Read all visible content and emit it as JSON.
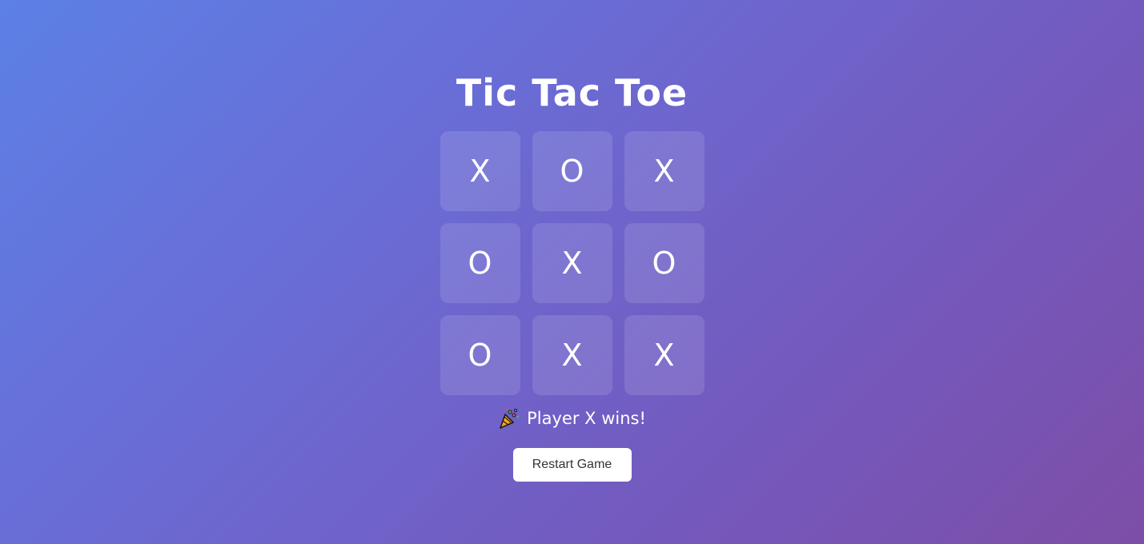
{
  "title": "Tic Tac Toe",
  "board": {
    "cells": [
      "X",
      "O",
      "X",
      "O",
      "X",
      "O",
      "O",
      "X",
      "X"
    ]
  },
  "status": {
    "icon": "party-popper-icon",
    "text": "Player X wins!"
  },
  "restart_label": "Restart Game",
  "colors": {
    "gradient_start": "#5c80e6",
    "gradient_end": "#7d4ea7",
    "cell_background": "rgba(255,255,255,0.12)",
    "button_background": "#ffffff",
    "button_text": "#333333"
  }
}
